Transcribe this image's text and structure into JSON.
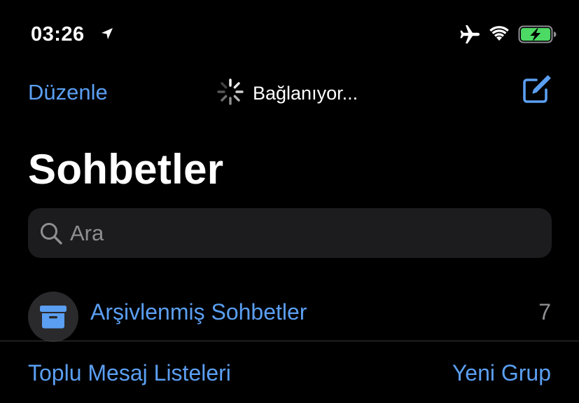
{
  "status_bar": {
    "time": "03:26",
    "icons": [
      "location-arrow-icon",
      "airplane-mode-icon",
      "wifi-icon",
      "battery-charging-icon"
    ],
    "battery_color": "#4cd964"
  },
  "nav": {
    "edit_label": "Düzenle",
    "connecting_text": "Bağlanıyor...",
    "compose_icon": "compose-icon"
  },
  "page_title": "Sohbetler",
  "search": {
    "placeholder": "Ara",
    "value": ""
  },
  "archived": {
    "label": "Arşivlenmiş Sohbetler",
    "count": "7",
    "icon": "archive-box-icon"
  },
  "footer": {
    "broadcast_label": "Toplu Mesaj Listeleri",
    "new_group_label": "Yeni Grup"
  },
  "colors": {
    "accent": "#5b9ff2",
    "background": "#000000",
    "search_bg": "#1c1c1e",
    "secondary_text": "#8e8e93"
  }
}
